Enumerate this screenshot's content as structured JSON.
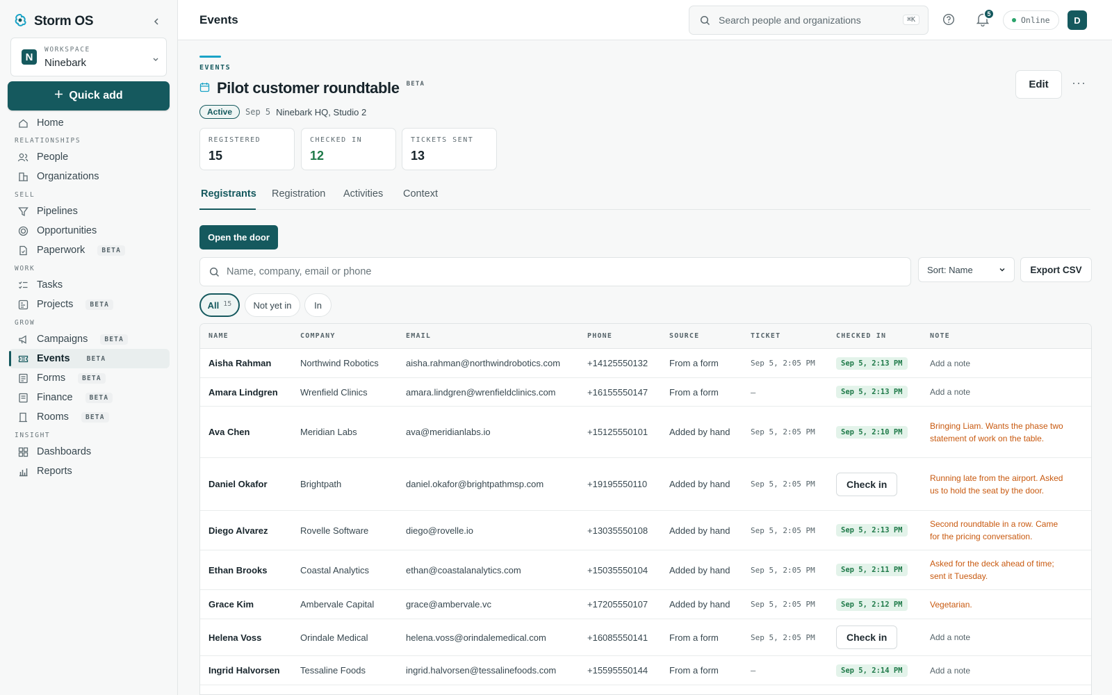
{
  "brand": {
    "name": "Storm OS"
  },
  "workspace": {
    "kicker": "WORKSPACE",
    "name": "Ninebark",
    "initial": "N"
  },
  "quick_add": "Quick add",
  "nav": {
    "home": "Home",
    "sec_relationships": "RELATIONSHIPS",
    "people": "People",
    "organizations": "Organizations",
    "sec_sell": "SELL",
    "pipelines": "Pipelines",
    "opportunities": "Opportunities",
    "paperwork": "Paperwork",
    "sec_work": "WORK",
    "tasks": "Tasks",
    "projects": "Projects",
    "sec_grow": "GROW",
    "campaigns": "Campaigns",
    "events": "Events",
    "forms": "Forms",
    "finance": "Finance",
    "rooms": "Rooms",
    "sec_insight": "INSIGHT",
    "dashboards": "Dashboards",
    "reports": "Reports",
    "beta": "BETA"
  },
  "topbar": {
    "title": "Events",
    "search_placeholder": "Search people and organizations",
    "shortcut": "⌘K",
    "notifications": "5",
    "status": "Online",
    "avatar": "D"
  },
  "event": {
    "kicker": "EVENTS",
    "title": "Pilot customer roundtable",
    "beta": "BETA",
    "status": "Active",
    "date": "Sep 5",
    "location": "Ninebark HQ, Studio 2",
    "edit": "Edit",
    "more": "···"
  },
  "stats": [
    {
      "label": "REGISTERED",
      "value": "15",
      "color": "#17242b"
    },
    {
      "label": "CHECKED IN",
      "value": "12",
      "color": "#1f7a49"
    },
    {
      "label": "TICKETS SENT",
      "value": "13",
      "color": "#17242b"
    }
  ],
  "tabs": [
    "Registrants",
    "Registration",
    "Activities",
    "Context"
  ],
  "open_door": "Open the door",
  "filter_placeholder": "Name, company, email or phone",
  "sort": "Sort: Name",
  "export": "Export CSV",
  "chips": {
    "all": "All",
    "all_count": "15",
    "not_yet": "Not yet in",
    "in": "In"
  },
  "columns": [
    "NAME",
    "COMPANY",
    "EMAIL",
    "PHONE",
    "SOURCE",
    "TICKET",
    "CHECKED IN",
    "NOTE"
  ],
  "rows": [
    {
      "name": "Aisha Rahman",
      "company": "Northwind Robotics",
      "email": "aisha.rahman@northwindrobotics.com",
      "phone": "+14125550132",
      "source": "From a form",
      "ticket": "Sep 5, 2:05 PM",
      "checked": "Sep 5, 2:13 PM",
      "note": "Add a note"
    },
    {
      "name": "Amara Lindgren",
      "company": "Wrenfield Clinics",
      "email": "amara.lindgren@wrenfieldclinics.com",
      "phone": "+16155550147",
      "source": "From a form",
      "ticket": "–",
      "checked": "Sep 5, 2:13 PM",
      "note": "Add a note"
    },
    {
      "name": "Ava Chen",
      "company": "Meridian Labs",
      "email": "ava@meridianlabs.io",
      "phone": "+15125550101",
      "source": "Added by hand",
      "ticket": "Sep 5, 2:05 PM",
      "checked": "Sep 5, 2:10 PM",
      "note": "Bringing Liam. Wants the phase two statement of work on the table."
    },
    {
      "name": "Daniel Okafor",
      "company": "Brightpath",
      "email": "daniel.okafor@brightpathmsp.com",
      "phone": "+19195550110",
      "source": "Added by hand",
      "ticket": "Sep 5, 2:05 PM",
      "checked": "Check in",
      "note": "Running late from the airport. Asked us to hold the seat by the door."
    },
    {
      "name": "Diego Alvarez",
      "company": "Rovelle Software",
      "email": "diego@rovelle.io",
      "phone": "+13035550108",
      "source": "Added by hand",
      "ticket": "Sep 5, 2:05 PM",
      "checked": "Sep 5, 2:13 PM",
      "note": "Second roundtable in a row. Came for the pricing conversation."
    },
    {
      "name": "Ethan Brooks",
      "company": "Coastal Analytics",
      "email": "ethan@coastalanalytics.com",
      "phone": "+15035550104",
      "source": "Added by hand",
      "ticket": "Sep 5, 2:05 PM",
      "checked": "Sep 5, 2:11 PM",
      "note": "Asked for the deck ahead of time; sent it Tuesday."
    },
    {
      "name": "Grace Kim",
      "company": "Ambervale Capital",
      "email": "grace@ambervale.vc",
      "phone": "+17205550107",
      "source": "Added by hand",
      "ticket": "Sep 5, 2:05 PM",
      "checked": "Sep 5, 2:12 PM",
      "note": "Vegetarian."
    },
    {
      "name": "Helena Voss",
      "company": "Orindale Medical",
      "email": "helena.voss@orindalemedical.com",
      "phone": "+16085550141",
      "source": "From a form",
      "ticket": "Sep 5, 2:05 PM",
      "checked": "Check in",
      "note": "Add a note"
    },
    {
      "name": "Ingrid Halvorsen",
      "company": "Tessaline Foods",
      "email": "ingrid.halvorsen@tessalinefoods.com",
      "phone": "+15595550144",
      "source": "From a form",
      "ticket": "–",
      "checked": "Sep 5, 2:14 PM",
      "note": "Add a note"
    }
  ]
}
